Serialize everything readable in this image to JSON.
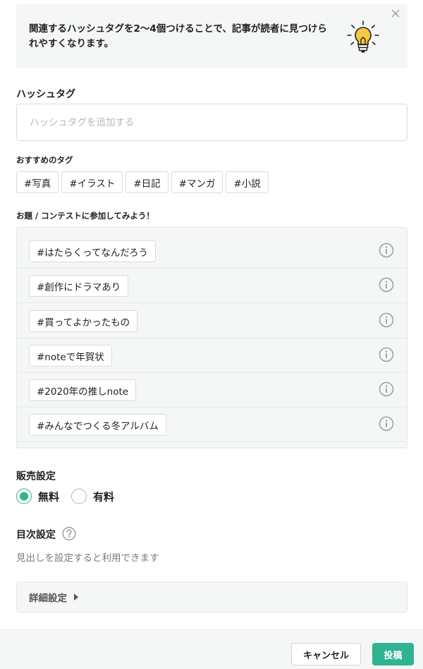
{
  "tip": {
    "text": "関連するハッシュタグを2〜4個つけることで、記事が読者に見つけられやすくなります。",
    "icon": "lightbulb-icon",
    "close_icon": "close-icon"
  },
  "hashtag": {
    "label": "ハッシュタグ",
    "placeholder": "ハッシュタグを追加する",
    "value": ""
  },
  "recommended": {
    "label": "おすすめのタグ",
    "tags": [
      "#写真",
      "#イラスト",
      "#日記",
      "#マンガ",
      "#小説"
    ]
  },
  "contest": {
    "label": "お題 / コンテストに参加してみよう！",
    "tags": [
      "#はたらくってなんだろう",
      "#創作にドラマあり",
      "#買ってよかったもの",
      "#noteで年賀状",
      "#2020年の推しnote",
      "#みんなでつくる冬アルバム"
    ],
    "info_icon": "info-icon"
  },
  "sales": {
    "label": "販売設定",
    "options": [
      {
        "label": "無料",
        "checked": true
      },
      {
        "label": "有料",
        "checked": false
      }
    ]
  },
  "toc": {
    "label": "目次設定",
    "help_icon": "question-icon",
    "description": "見出しを設定すると利用できます"
  },
  "details": {
    "label": "詳細設定",
    "icon": "caret-right-icon"
  },
  "footer": {
    "cancel_label": "キャンセル",
    "post_label": "投稿"
  },
  "colors": {
    "accent": "#2fb391",
    "panel_bg": "#f5f7f7",
    "bulb": "#f5c842"
  }
}
